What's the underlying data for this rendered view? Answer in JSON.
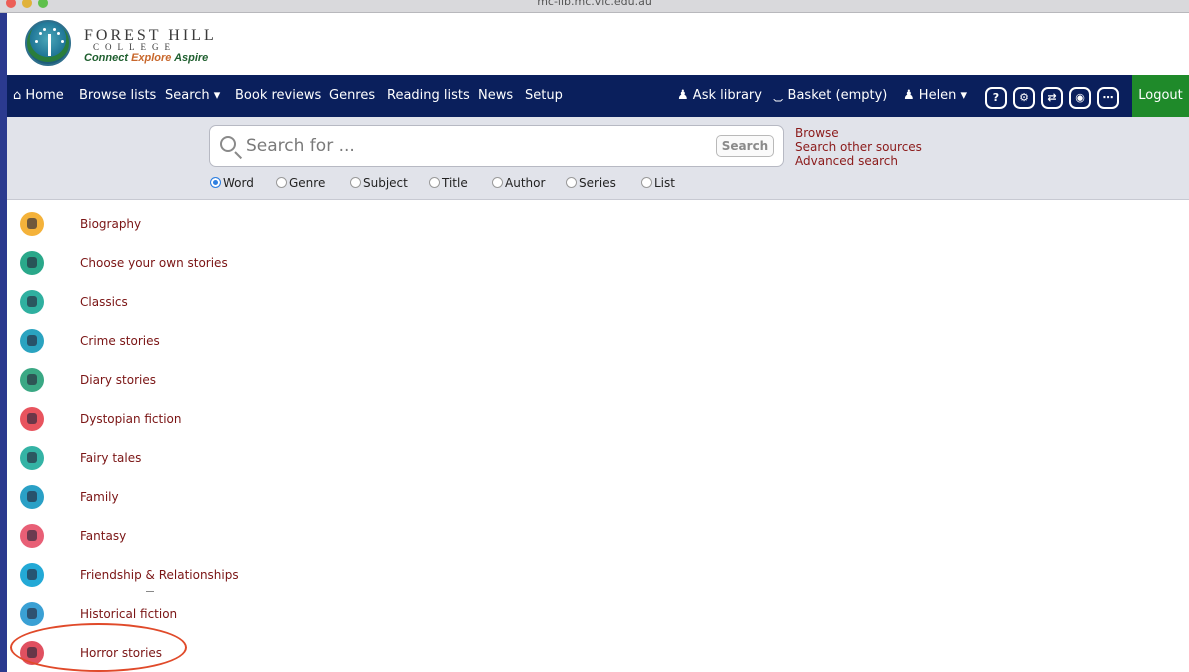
{
  "window": {
    "url": "mc-lib.mc.vic.edu.au"
  },
  "logo": {
    "line1": "FOREST HILL",
    "line2": "COLLEGE",
    "tagline_part1": "Connect ",
    "tagline_part2": "Explore ",
    "tagline_part3": "Aspire"
  },
  "nav": {
    "home": "Home",
    "browse_lists": "Browse lists",
    "search": "Search ▾",
    "book_reviews": "Book reviews",
    "genres": "Genres",
    "reading_lists": "Reading lists",
    "news": "News",
    "setup": "Setup",
    "ask_library": "Ask library",
    "basket": "Basket (empty)",
    "user": "Helen ▾",
    "logout": "Logout"
  },
  "search": {
    "placeholder": "Search for ...",
    "button": "Search",
    "links": [
      "Browse",
      "Search other sources",
      "Advanced search"
    ],
    "options": [
      "Word",
      "Genre",
      "Subject",
      "Title",
      "Author",
      "Series",
      "List"
    ],
    "selected": "Word"
  },
  "genres": [
    {
      "label": "Biography",
      "color": "#f4b23a"
    },
    {
      "label": "Choose your own stories",
      "color": "#2aa88a"
    },
    {
      "label": "Classics",
      "color": "#2fb0a0"
    },
    {
      "label": "Crime stories",
      "color": "#2aa3c0"
    },
    {
      "label": "Diary stories",
      "color": "#3aa884"
    },
    {
      "label": "Dystopian fiction",
      "color": "#e8545e"
    },
    {
      "label": "Fairy tales",
      "color": "#34b3a5"
    },
    {
      "label": "Family",
      "color": "#2aa0c6"
    },
    {
      "label": "Fantasy",
      "color": "#e85f76"
    },
    {
      "label": "Friendship & Relationships",
      "color": "#23a9d6"
    },
    {
      "label": "Historical fiction",
      "color": "#3aa0d4"
    },
    {
      "label": "Horror stories",
      "color": "#e05060"
    }
  ]
}
